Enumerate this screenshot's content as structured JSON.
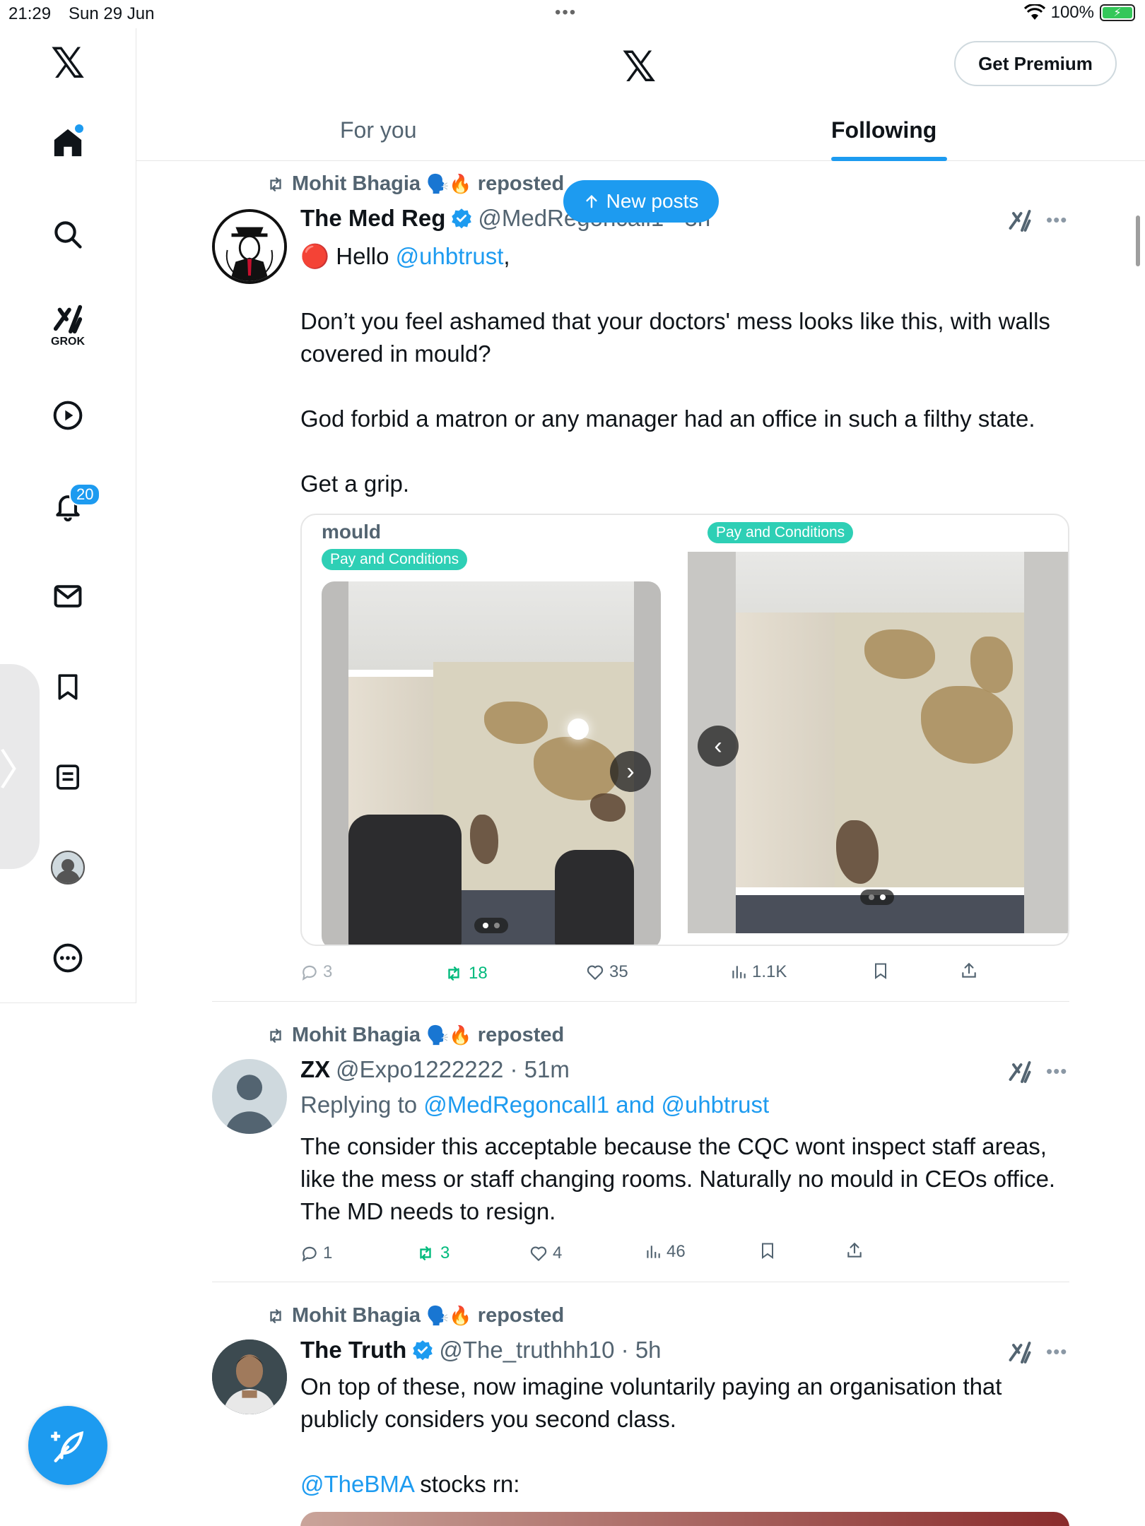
{
  "status_bar": {
    "time": "21:29",
    "date": "Sun 29 Jun",
    "battery": "100%",
    "dots": "•••"
  },
  "nav": {
    "logo": "𝕏",
    "grok_label": "GROK",
    "notifications_badge": "20",
    "side_handle": "〉"
  },
  "header": {
    "logo": "𝕏",
    "premium_label": "Get Premium",
    "tabs": [
      {
        "label": "For you",
        "active": false
      },
      {
        "label": "Following",
        "active": true
      }
    ]
  },
  "new_posts_label": "New posts",
  "posts": [
    {
      "repost_by": "Mohit Bhagia",
      "repost_emojis": "🗣️🔥",
      "repost_suffix": "reposted",
      "name": "The Med Reg",
      "handle": "@MedRegoncall1 · 3h",
      "text_hello_prefix": "🔴 Hello ",
      "text_hello_mention": "@uhbtrust",
      "text_hello_suffix": ",",
      "paragraphs": [
        "Don’t you feel ashamed that your doctors' mess looks like this, with walls covered in mould?",
        "God forbid a matron or any manager had an office in such a filthy state.",
        "Get a grip."
      ],
      "media": {
        "title": "mould",
        "tags": [
          "Pay and Conditions",
          "Pay and Conditions"
        ]
      },
      "stats": {
        "replies": "3",
        "reposts": "18",
        "likes": "35",
        "views": "1.1K"
      }
    },
    {
      "repost_by": "Mohit Bhagia",
      "repost_emojis": "🗣️🔥",
      "repost_suffix": "reposted",
      "name": "ZX",
      "handle": "@Expo1222222 · 51m",
      "reply_prefix": "Replying to ",
      "reply_to": "@MedRegoncall1 and @uhbtrust",
      "text": "The consider this acceptable because the CQC wont inspect staff areas, like the mess or staff changing rooms. Naturally no  mould in CEOs office. The MD needs to resign.",
      "stats": {
        "replies": "1",
        "reposts": "3",
        "likes": "4",
        "views": "46"
      }
    },
    {
      "repost_by": "Mohit Bhagia",
      "repost_emojis": "🗣️🔥",
      "repost_suffix": "reposted",
      "name": "The Truth",
      "handle": "@The_truthhh10 · 5h",
      "text": "On top of these, now imagine voluntarily paying an organisation that publicly considers you second class.",
      "text2_mention": "@TheBMA",
      "text2_suffix": " stocks rn:"
    }
  ],
  "colors": {
    "accent": "#1d9bf0",
    "retweet": "#00ba7c",
    "muted": "#536471",
    "tag": "#2ecfb5"
  }
}
